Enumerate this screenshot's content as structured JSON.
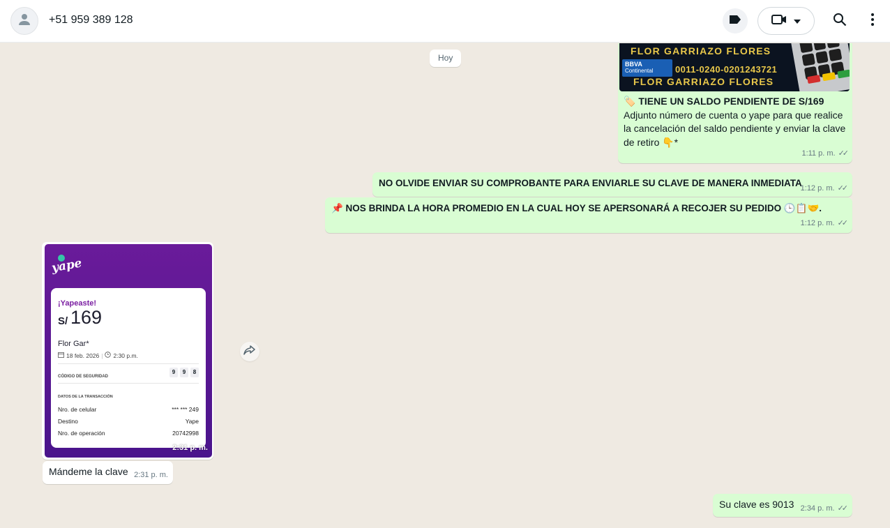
{
  "header": {
    "contact_name": "+51 959 389 128",
    "icons": [
      "person-icon",
      "label-icon",
      "video-call-icon",
      "chevron-down-icon",
      "search-icon",
      "more-vert-icon"
    ]
  },
  "chat": {
    "date_separator": "Hoy",
    "messages": [
      {
        "type": "outgoing-image",
        "image_text_line1": "FLOR GARRIAZO FLORES",
        "image_bank_name": "BBVA",
        "image_bank_sub": "Continental",
        "image_account": "0011-0240-0201243721",
        "image_text_line2": "FLOR GARRIAZO FLORES",
        "caption_bold": "🏷️ TIENE UN SALDO PENDIENTE DE S/169",
        "caption": " Adjunto número de cuenta o yape para que realice la cancelación del saldo pendiente y enviar la clave de retiro 👇*",
        "time": "1:11 p. m.",
        "ticks": "✓✓"
      },
      {
        "type": "outgoing-text",
        "text": "NO OLVIDE ENVIAR SU COMPROBANTE PARA ENVIARLE SU CLAVE DE MANERA INMEDIATA",
        "time": "1:12 p. m.",
        "ticks": "✓✓"
      },
      {
        "type": "outgoing-text",
        "text": "📌 NOS BRINDA LA HORA PROMEDIO EN LA CUAL HOY SE APERSONARÁ A RECOJER SU PEDIDO 🕒📋🤝.",
        "time": "1:12 p. m.",
        "ticks": "✓✓"
      },
      {
        "type": "incoming-image",
        "yape": {
          "logo": "yape",
          "title": "¡Yapeaste!",
          "currency": "S/",
          "amount": "169",
          "name": "Flor Gar*",
          "date": "18 feb. 2026",
          "time": "2:30 p.m.",
          "security_label": "CÓDIGO DE SEGURIDAD",
          "security_digits": [
            "9",
            "9",
            "8"
          ],
          "data_label": "DATOS DE LA TRANSACCIÓN",
          "rows": [
            {
              "label": "Nro. de celular",
              "value": "*** *** 249"
            },
            {
              "label": "Destino",
              "value": "Yape"
            },
            {
              "label": "Nro. de operación",
              "value": "20742998"
            }
          ]
        },
        "time": "2:31 p. m."
      },
      {
        "type": "incoming-text",
        "text": "Mándeme la clave",
        "time": "2:31 p. m."
      },
      {
        "type": "outgoing-text",
        "text": "Su clave es 9013",
        "time": "2:34 p. m.",
        "ticks": "✓✓"
      }
    ]
  },
  "colors": {
    "outgoing_bubble": "#d9fdd3",
    "incoming_bubble": "#ffffff",
    "chat_background": "#efeae2",
    "yape_purple": "#6a1b9a"
  }
}
